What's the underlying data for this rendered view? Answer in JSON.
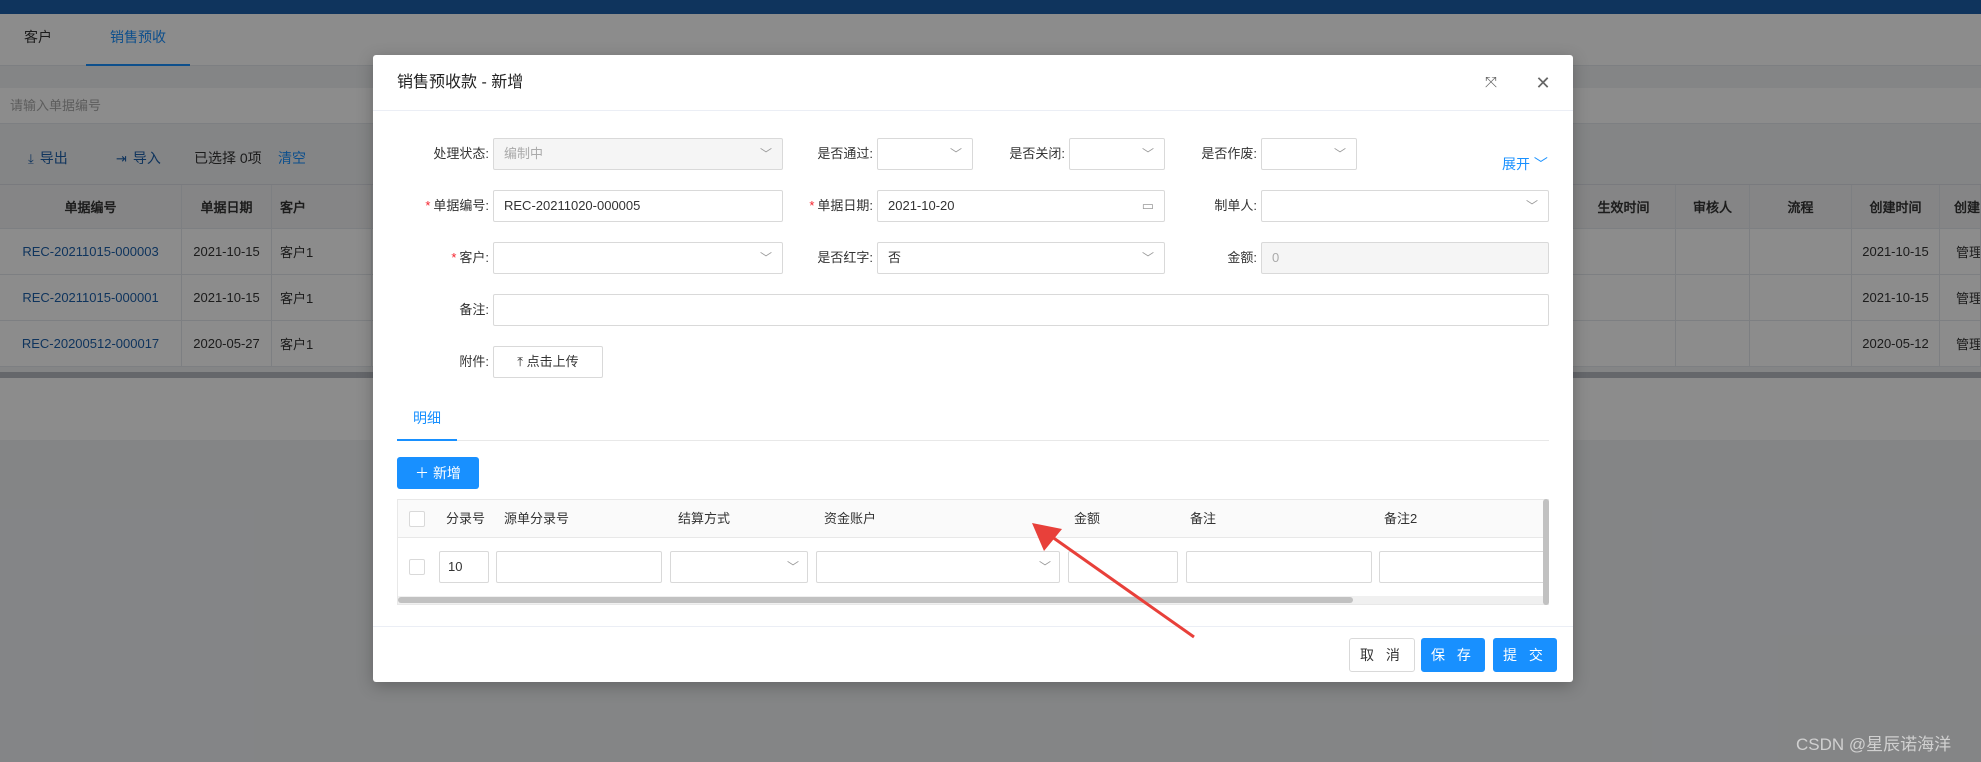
{
  "app": {
    "tabs": [
      {
        "label": "客户"
      },
      {
        "label": "销售预收"
      }
    ],
    "search_placeholder": "请输入单据编号",
    "toolbar": {
      "export_label": "导出",
      "import_label": "导入",
      "selected_text": "已选择 0项",
      "clear_label": "清空"
    },
    "grid": {
      "headers": [
        "单据编号",
        "单据日期",
        "客户",
        "生效时间",
        "审核人",
        "流程",
        "创建时间",
        "创建"
      ],
      "rows": [
        {
          "no": "REC-20211015-000003",
          "date": "2021-10-15",
          "customer": "客户1",
          "created": "2021-10-15",
          "creator": "管理"
        },
        {
          "no": "REC-20211015-000001",
          "date": "2021-10-15",
          "customer": "客户1",
          "created": "2021-10-15",
          "creator": "管理"
        },
        {
          "no": "REC-20200512-000017",
          "date": "2020-05-27",
          "customer": "客户1",
          "created": "2020-05-12",
          "creator": "管理"
        }
      ]
    }
  },
  "modal": {
    "title": "销售预收款 - 新增",
    "expand_label": "展开",
    "form": {
      "status_label": "处理状态:",
      "status_value": "编制中",
      "passed_label": "是否通过:",
      "closed_label": "是否关闭:",
      "voided_label": "是否作废:",
      "doc_no_label": "单据编号:",
      "doc_no_value": "REC-20211020-000005",
      "doc_date_label": "单据日期:",
      "doc_date_value": "2021-10-20",
      "maker_label": "制单人:",
      "customer_label": "客户:",
      "red_label": "是否红字:",
      "red_value": "否",
      "amount_label": "金额:",
      "amount_value": "0",
      "remark_label": "备注:",
      "attach_label": "附件:",
      "upload_label": "点击上传"
    },
    "detail_tab": "明细",
    "add_label": "新增",
    "detail": {
      "headers": {
        "entry_no": "分录号",
        "src_entry": "源单分录号",
        "settle": "结算方式",
        "account": "资金账户",
        "amount": "金额",
        "remark": "备注",
        "remark2": "备注2"
      },
      "row": {
        "entry_no": "10"
      }
    },
    "footer": {
      "cancel_label": "取 消",
      "save_label": "保 存",
      "submit_label": "提 交"
    }
  },
  "watermark": "CSDN @星辰诺海洋",
  "colors": {
    "primary": "#1890ff",
    "topbar": "#1c5fa9",
    "required": "#f5222d",
    "annotation": "#e8403a"
  }
}
